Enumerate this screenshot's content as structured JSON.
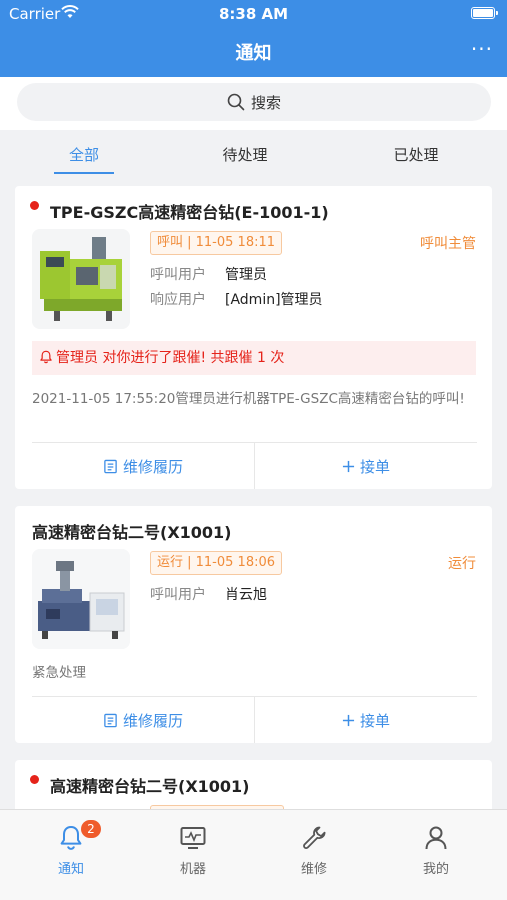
{
  "status_bar": {
    "carrier": "Carrier",
    "time": "8:38 AM"
  },
  "header": {
    "title": "通知",
    "more_icon": "ellipsis-icon"
  },
  "search": {
    "label": "搜索",
    "icon": "search-icon"
  },
  "tabs": [
    {
      "label": "全部",
      "active": true
    },
    {
      "label": "待处理",
      "active": false
    },
    {
      "label": "已处理",
      "active": false
    }
  ],
  "cards": [
    {
      "unread": true,
      "title": "TPE-GSZC高速精密台钻(E-1001-1)",
      "badge": "呼叫 | 11-05 18:11",
      "status_right": "呼叫主管",
      "fields": [
        {
          "key": "呼叫用户",
          "value": "管理员"
        },
        {
          "key": "响应用户",
          "value": "[Admin]管理员"
        }
      ],
      "alert": "管理员 对你进行了跟催! 共跟催 1 次",
      "description": "2021-11-05 17:55:20管理员进行机器TPE-GSZC高速精密台钻的呼叫!",
      "actions": {
        "history": "维修履历",
        "accept": "接单"
      }
    },
    {
      "unread": false,
      "title": "高速精密台钻二号(X1001)",
      "badge": "运行 | 11-05 18:06",
      "status_right": "运行",
      "fields": [
        {
          "key": "呼叫用户",
          "value": "肖云旭"
        }
      ],
      "description": "紧急处理",
      "actions": {
        "history": "维修履历",
        "accept": "接单"
      }
    },
    {
      "unread": true,
      "title": "高速精密台钻二号(X1001)"
    }
  ],
  "bottom_nav": [
    {
      "label": "通知",
      "icon": "bell-icon",
      "badge": "2",
      "active": true
    },
    {
      "label": "机器",
      "icon": "monitor-icon",
      "active": false
    },
    {
      "label": "维修",
      "icon": "wrench-icon",
      "active": false
    },
    {
      "label": "我的",
      "icon": "user-icon",
      "active": false
    }
  ],
  "colors": {
    "primary": "#3d8ee6",
    "accent_orange": "#f08c3a",
    "alert_red": "#e5231a",
    "background": "#f1f2f4"
  }
}
